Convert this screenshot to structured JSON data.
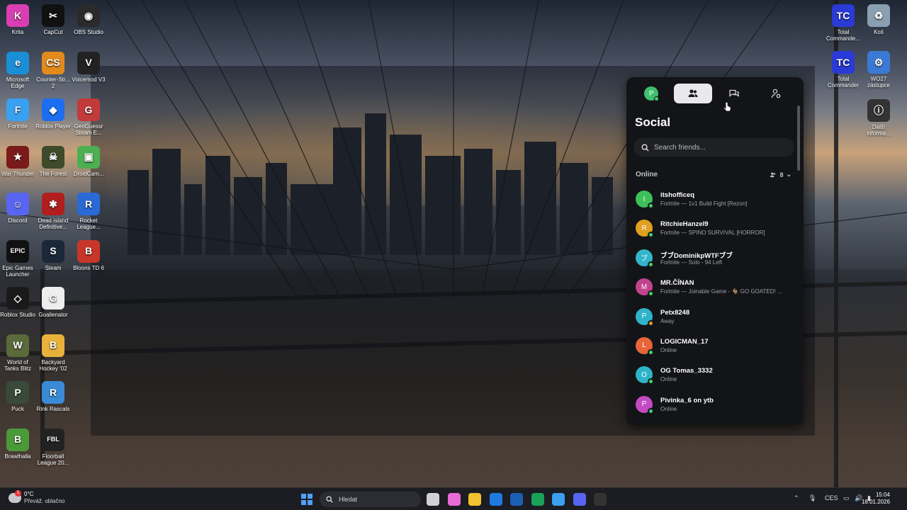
{
  "desktop": {
    "icons": [
      {
        "label": "Krita",
        "color": "#d93fb0",
        "glyph": "K"
      },
      {
        "label": "CapCut",
        "color": "#111111",
        "glyph": "✂"
      },
      {
        "label": "OBS Studio",
        "color": "#2a2a2a",
        "glyph": "◉"
      },
      {
        "label": "Microsoft Edge",
        "color": "#1b8fd6",
        "glyph": "e"
      },
      {
        "label": "Counter-Str... 2",
        "color": "#e28a1c",
        "glyph": "CS"
      },
      {
        "label": "Voicemod V3",
        "color": "#222222",
        "glyph": "V"
      },
      {
        "label": "Fortnite",
        "color": "#3aa0f0",
        "glyph": "F"
      },
      {
        "label": "Roblox Player",
        "color": "#1d6df0",
        "glyph": "◆"
      },
      {
        "label": "GeoGuessr Steam E...",
        "color": "#c23a3a",
        "glyph": "G"
      },
      {
        "label": "War Thunder",
        "color": "#7a1a1a",
        "glyph": "★"
      },
      {
        "label": "The Forest",
        "color": "#3e4a2a",
        "glyph": "☠"
      },
      {
        "label": "DroidCam...",
        "color": "#4caf50",
        "glyph": "▣"
      },
      {
        "label": "Discord",
        "color": "#5865f2",
        "glyph": "☺"
      },
      {
        "label": "Dead Island Definitive...",
        "color": "#b01e1e",
        "glyph": "✱"
      },
      {
        "label": "Rocket League...",
        "color": "#2a6ad6",
        "glyph": "R"
      },
      {
        "label": "Epic Games Launcher",
        "color": "#111111",
        "glyph": "EPIC"
      },
      {
        "label": "Steam",
        "color": "#1b2838",
        "glyph": "S"
      },
      {
        "label": "Bloons TD 6",
        "color": "#c8362a",
        "glyph": "B"
      },
      {
        "label": "Roblox Studio",
        "color": "#1a1a1a",
        "glyph": "◇"
      },
      {
        "label": "Goalienator",
        "color": "#eeeeee",
        "glyph": "G"
      },
      {
        "label": "World of Tanks Blitz",
        "color": "#5a6a3a",
        "glyph": "W"
      },
      {
        "label": "Backyard Hockey '02",
        "color": "#e8b23a",
        "glyph": "B"
      },
      {
        "label": "Puck",
        "color": "#3a4a3a",
        "glyph": "P"
      },
      {
        "label": "Rink Rascals",
        "color": "#3a8ad6",
        "glyph": "R"
      },
      {
        "label": "Brawlhalla",
        "color": "#4a9a3a",
        "glyph": "B"
      },
      {
        "label": "Floorball League 20...",
        "color": "#222222",
        "glyph": "FBL"
      }
    ],
    "right_icons": [
      {
        "label": "Total Commande...",
        "color": "#2a3ad6",
        "glyph": "TC"
      },
      {
        "label": "Koš",
        "color": "#8aa0b0",
        "glyph": "♻"
      },
      {
        "label": "Total Commander",
        "color": "#2a3ad6",
        "glyph": "TC"
      },
      {
        "label": "WO27 zástupce",
        "color": "#3a7ad6",
        "glyph": "⚙"
      },
      {
        "label": "Další informa...",
        "color": "#333333",
        "glyph": "ⓘ"
      }
    ]
  },
  "social": {
    "title": "Social",
    "self_avatar_letter": "P",
    "search_placeholder": "Search friends...",
    "section_label": "Online",
    "online_count": "8",
    "friends": [
      {
        "name": "itshofficeq",
        "status": "Fortnite — 1v1 Build Fight [Rezon]",
        "avatar_letter": "I",
        "avatar_color": "#3fbf5a",
        "status_color": "#3dd36b"
      },
      {
        "name": "RitchieHanzel9",
        "status": "Fortnite — SPINO SURVIVAL [HORROR]",
        "avatar_letter": "R",
        "avatar_color": "#e0a020",
        "status_color": "#3dd36b"
      },
      {
        "name": "ブブDominikpWTFブブ",
        "status": "Fortnite — Solo - 94 Left",
        "avatar_letter": "ブ",
        "avatar_color": "#32b5c9",
        "status_color": "#3dd36b"
      },
      {
        "name": "MR.ČÍNAN",
        "status": "Fortnite — Joinable Game - 🐐 GO GOATED! ...",
        "avatar_letter": "M",
        "avatar_color": "#c2448e",
        "status_color": "#3dd36b"
      },
      {
        "name": "Petx8248",
        "status": "Away",
        "avatar_letter": "P",
        "avatar_color": "#2fb3c8",
        "status_color": "#e0a020"
      },
      {
        "name": "LOGICMAN_17",
        "status": "Online",
        "avatar_letter": "L",
        "avatar_color": "#e8643a",
        "status_color": "#3dd36b"
      },
      {
        "name": "OG Tomas_3332",
        "status": "Online",
        "avatar_letter": "O",
        "avatar_color": "#2fb3c8",
        "status_color": "#3dd36b"
      },
      {
        "name": "Pivinka_6 on ytb",
        "status": "Online",
        "avatar_letter": "P",
        "avatar_color": "#c24ac2",
        "status_color": "#3dd36b"
      }
    ]
  },
  "taskbar": {
    "weather_temp": "0°C",
    "weather_desc": "Převáž. oblačno",
    "weather_badge": "1",
    "search_label": "Hledat",
    "language": "CES",
    "time": "15:04",
    "date": "18.01.2026",
    "apps": [
      {
        "name": "task-view",
        "color": "#d0d0d5"
      },
      {
        "name": "copilot",
        "color": "#e86ad6"
      },
      {
        "name": "file-explorer",
        "color": "#f2c230"
      },
      {
        "name": "outlook",
        "color": "#1f7ae0"
      },
      {
        "name": "calculator",
        "color": "#1a5fb4"
      },
      {
        "name": "edge",
        "color": "#1ba05a"
      },
      {
        "name": "fortnite",
        "color": "#3aa0f0"
      },
      {
        "name": "discord",
        "color": "#5865f2"
      },
      {
        "name": "obs",
        "color": "#333333"
      }
    ]
  }
}
